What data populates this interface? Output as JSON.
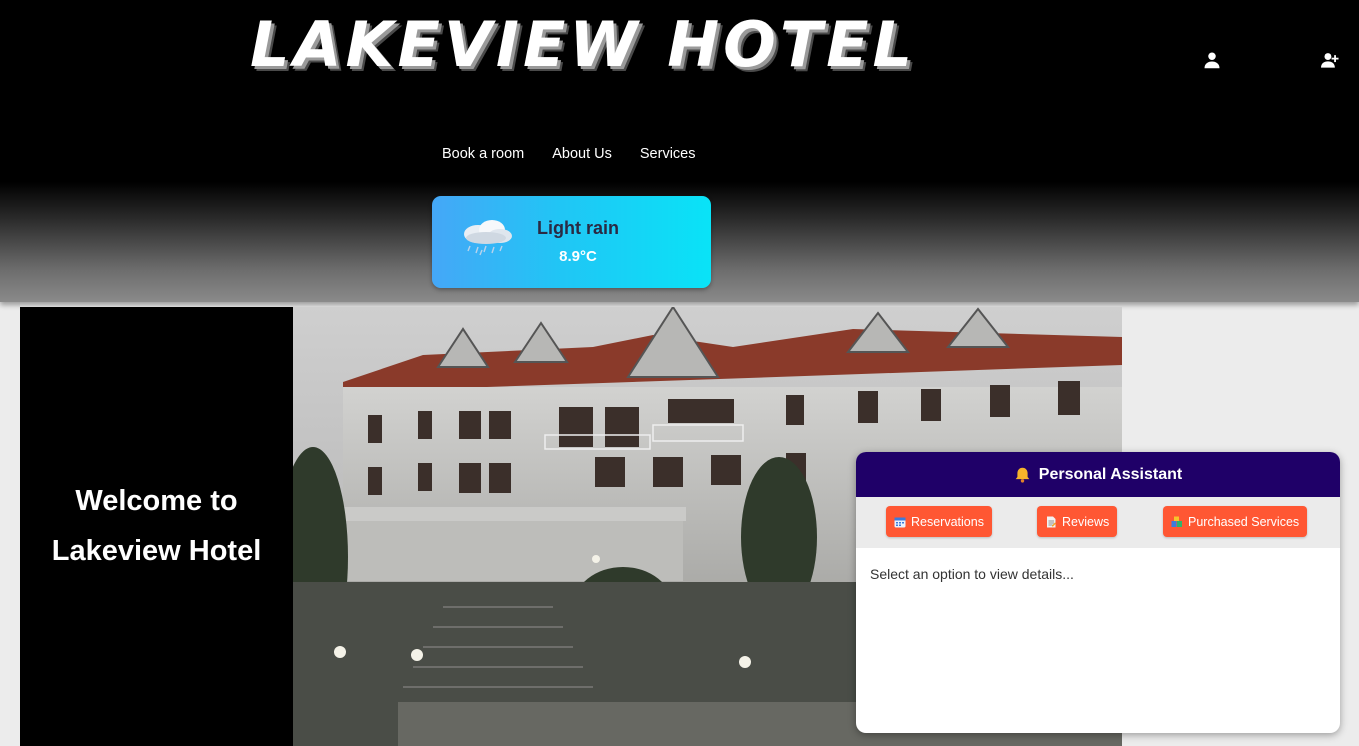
{
  "header": {
    "logo": "LAKEVIEW HOTEL",
    "user_icon": "user-icon",
    "register_icon": "user-plus-icon"
  },
  "nav": {
    "items": [
      "Book a room",
      "About Us",
      "Services"
    ]
  },
  "weather": {
    "icon": "cloud-rain-icon",
    "description": "Light rain",
    "temperature": "8.9°C"
  },
  "hero": {
    "welcome_line1": "Welcome to",
    "welcome_line2": "Lakeview Hotel",
    "image": "hotel-building-image"
  },
  "assistant": {
    "title": "Personal Assistant",
    "title_icon": "bell-icon",
    "tabs": [
      {
        "label": "Reservations",
        "icon": "calendar-icon"
      },
      {
        "label": "Reviews",
        "icon": "document-icon"
      },
      {
        "label": "Purchased Services",
        "icon": "blocks-icon"
      }
    ],
    "placeholder": "Select an option to view details..."
  },
  "colors": {
    "assistant_header": "#1f0068",
    "tab_button": "#ff5733",
    "weather_start": "#45a7f7",
    "weather_end": "#09e3f7"
  }
}
